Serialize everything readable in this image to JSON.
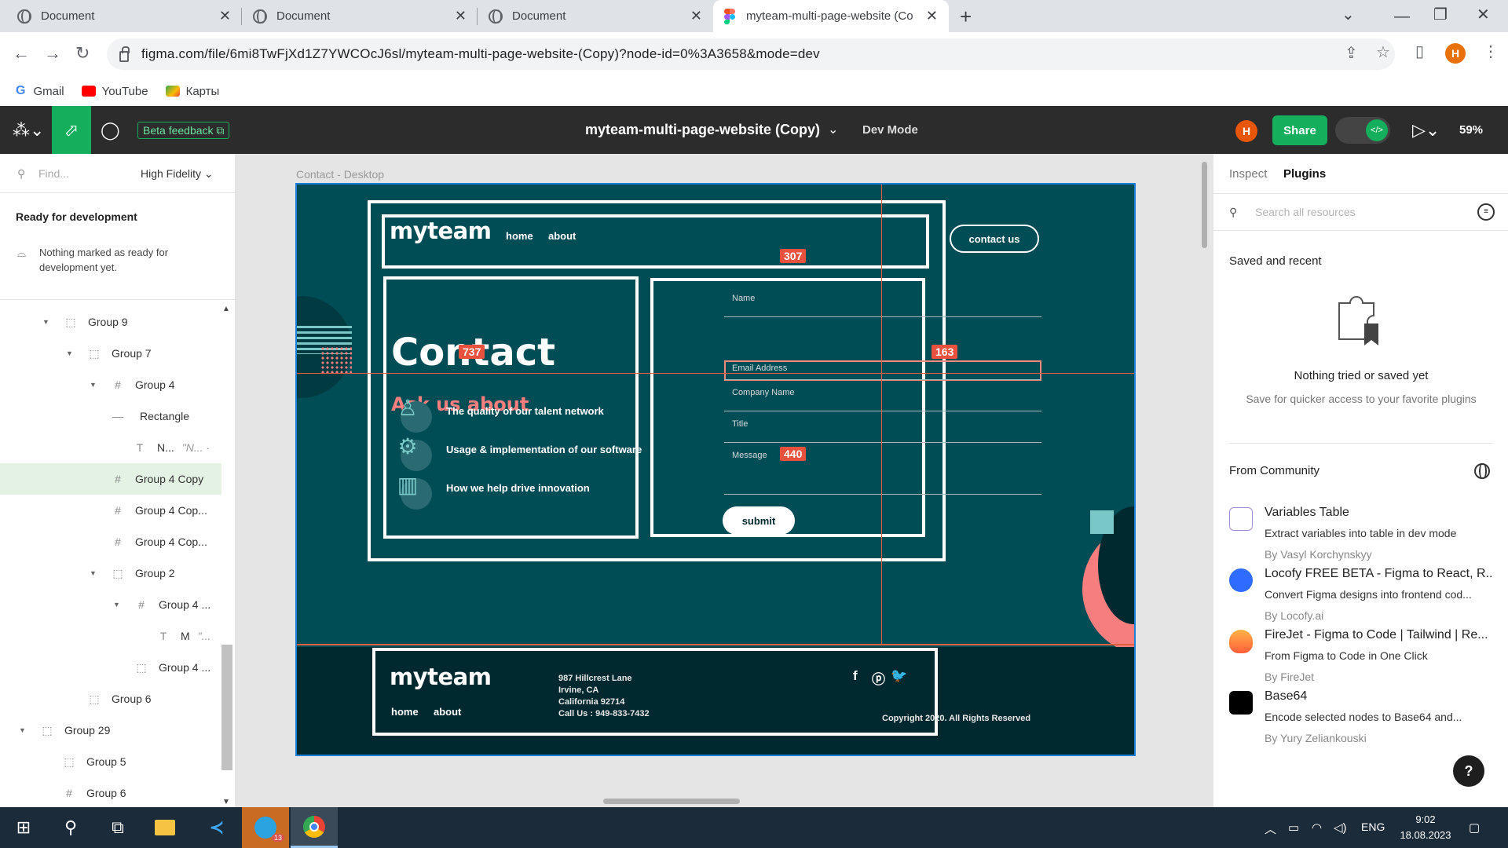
{
  "browser": {
    "tabs": [
      {
        "title": "Document"
      },
      {
        "title": "Document"
      },
      {
        "title": "Document"
      },
      {
        "title": "myteam-multi-page-website (Co"
      }
    ],
    "url": "figma.com/file/6mi8TwFjXd1Z7YWCOcJ6sl/myteam-multi-page-website-(Copy)?node-id=0%3A3658&mode=dev",
    "profile_initial": "H",
    "bookmarks": [
      "Gmail",
      "YouTube",
      "Карты"
    ]
  },
  "figma_toolbar": {
    "beta_feedback": "Beta feedback",
    "file_title": "myteam-multi-page-website (Copy)",
    "mode": "Dev Mode",
    "avatar_initial": "H",
    "share": "Share",
    "zoom": "59%"
  },
  "left_panel": {
    "search_placeholder": "Find...",
    "fidelity": "High Fidelity",
    "ready_heading": "Ready for development",
    "nothing_text": "Nothing marked as ready for development yet.",
    "layers": [
      {
        "name": "Group 9",
        "extra": ""
      },
      {
        "name": "Group 7",
        "extra": ""
      },
      {
        "name": "Group 4",
        "extra": ""
      },
      {
        "name": "Rectangle",
        "extra": ""
      },
      {
        "name": "N...",
        "extra": "\"N... ·"
      },
      {
        "name": "Group 4 Copy",
        "extra": ""
      },
      {
        "name": "Group 4 Cop...",
        "extra": ""
      },
      {
        "name": "Group 4 Cop...",
        "extra": ""
      },
      {
        "name": "Group 2",
        "extra": ""
      },
      {
        "name": "Group 4 ...",
        "extra": ""
      },
      {
        "name": "M",
        "extra": "\"..."
      },
      {
        "name": "Group 4 ...",
        "extra": ""
      },
      {
        "name": "Group 6",
        "extra": ""
      },
      {
        "name": "Group 29",
        "extra": ""
      },
      {
        "name": "Group 5",
        "extra": ""
      },
      {
        "name": "Group 6",
        "extra": ""
      }
    ]
  },
  "canvas": {
    "frame_label": "Contact - Desktop",
    "site": {
      "logo": "myteam",
      "nav": [
        "home",
        "about"
      ],
      "contact_button": "contact us",
      "heading": "Contact",
      "subheading": "Ask us about",
      "features": [
        "The quality of our talent network",
        "Usage & implementation of our software",
        "How we help drive innovation"
      ],
      "form_fields": [
        "Name",
        "Email Address",
        "Company Name",
        "Title",
        "Message"
      ],
      "submit": "submit",
      "footer": {
        "logo": "myteam",
        "nav": [
          "home",
          "about"
        ],
        "address": [
          "987  Hillcrest Lane",
          "Irvine, CA",
          "California 92714",
          "Call Us : 949-833-7432"
        ],
        "copyright": "Copyright 2020. All Rights Reserved"
      }
    },
    "measurements": [
      "307",
      "737",
      "163",
      "440"
    ]
  },
  "right_panel": {
    "tabs": [
      "Inspect",
      "Plugins"
    ],
    "search_placeholder": "Search all resources",
    "saved_heading": "Saved and recent",
    "empty_title": "Nothing tried or saved yet",
    "empty_sub": "Save for quicker access to your favorite plugins",
    "community_heading": "From Community",
    "plugins": [
      {
        "name": "Variables Table",
        "desc": "Extract variables into table in dev mode",
        "by": "By Vasyl Korchynskyy"
      },
      {
        "name": "Locofy FREE BETA - Figma to React, R...",
        "desc": "Convert Figma designs into frontend cod...",
        "by": "By Locofy.ai"
      },
      {
        "name": "FireJet - Figma to Code | Tailwind | Re...",
        "desc": "From Figma to Code in One Click",
        "by": "By FireJet"
      },
      {
        "name": "Base64",
        "desc": "Encode selected nodes to Base64 and...",
        "by": "By Yury Zeliankouski"
      }
    ],
    "help": "?"
  },
  "taskbar": {
    "lang": "ENG",
    "time": "9:02",
    "date": "18.08.2023",
    "telegram_badge": "13"
  },
  "colors": {
    "figma_green": "#14ae5c",
    "site_teal": "#014d56",
    "site_dark": "#00292f",
    "coral": "#f67e7e",
    "measure_red": "#e8513d"
  }
}
